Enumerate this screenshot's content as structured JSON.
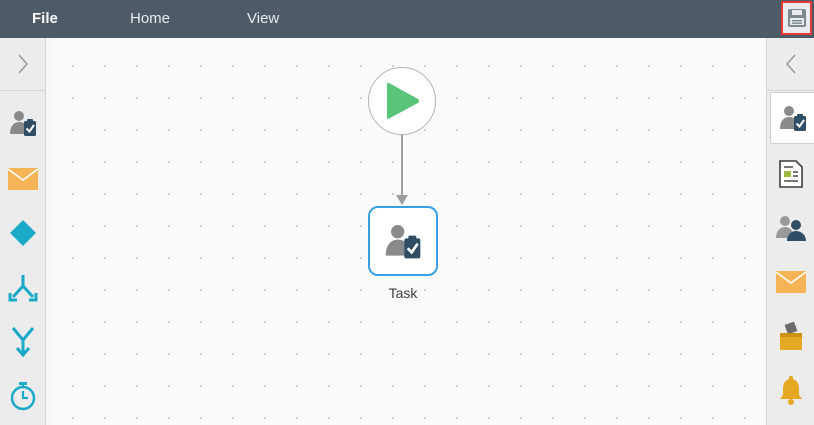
{
  "menu": {
    "file": "File",
    "home": "Home",
    "view": "View"
  },
  "toolbar": {
    "save_icon": "save-disk-icon"
  },
  "left_palette": {
    "toggle_icon": "chevron-right-icon",
    "items": [
      "user-task-icon",
      "mail-icon",
      "decision-diamond-icon",
      "split-arrows-icon",
      "merge-arrows-icon",
      "timer-icon"
    ]
  },
  "right_palette": {
    "toggle_icon": "chevron-left-icon",
    "items": [
      "user-task-icon",
      "form-document-icon",
      "user-group-icon",
      "mail-icon",
      "ballot-box-icon",
      "bell-icon"
    ]
  },
  "workflow": {
    "start_node": {
      "icon": "play-icon"
    },
    "task_node": {
      "label": "Task",
      "icon": "user-task-icon"
    }
  },
  "colors": {
    "topbar": "#4c5b66",
    "accent_blue": "#3aa0e6",
    "play_green": "#5ac47a",
    "teal": "#1aa9c7",
    "mail_orange": "#f5b455",
    "alert_yellow": "#e5a823",
    "save_highlight": "#e53935"
  }
}
